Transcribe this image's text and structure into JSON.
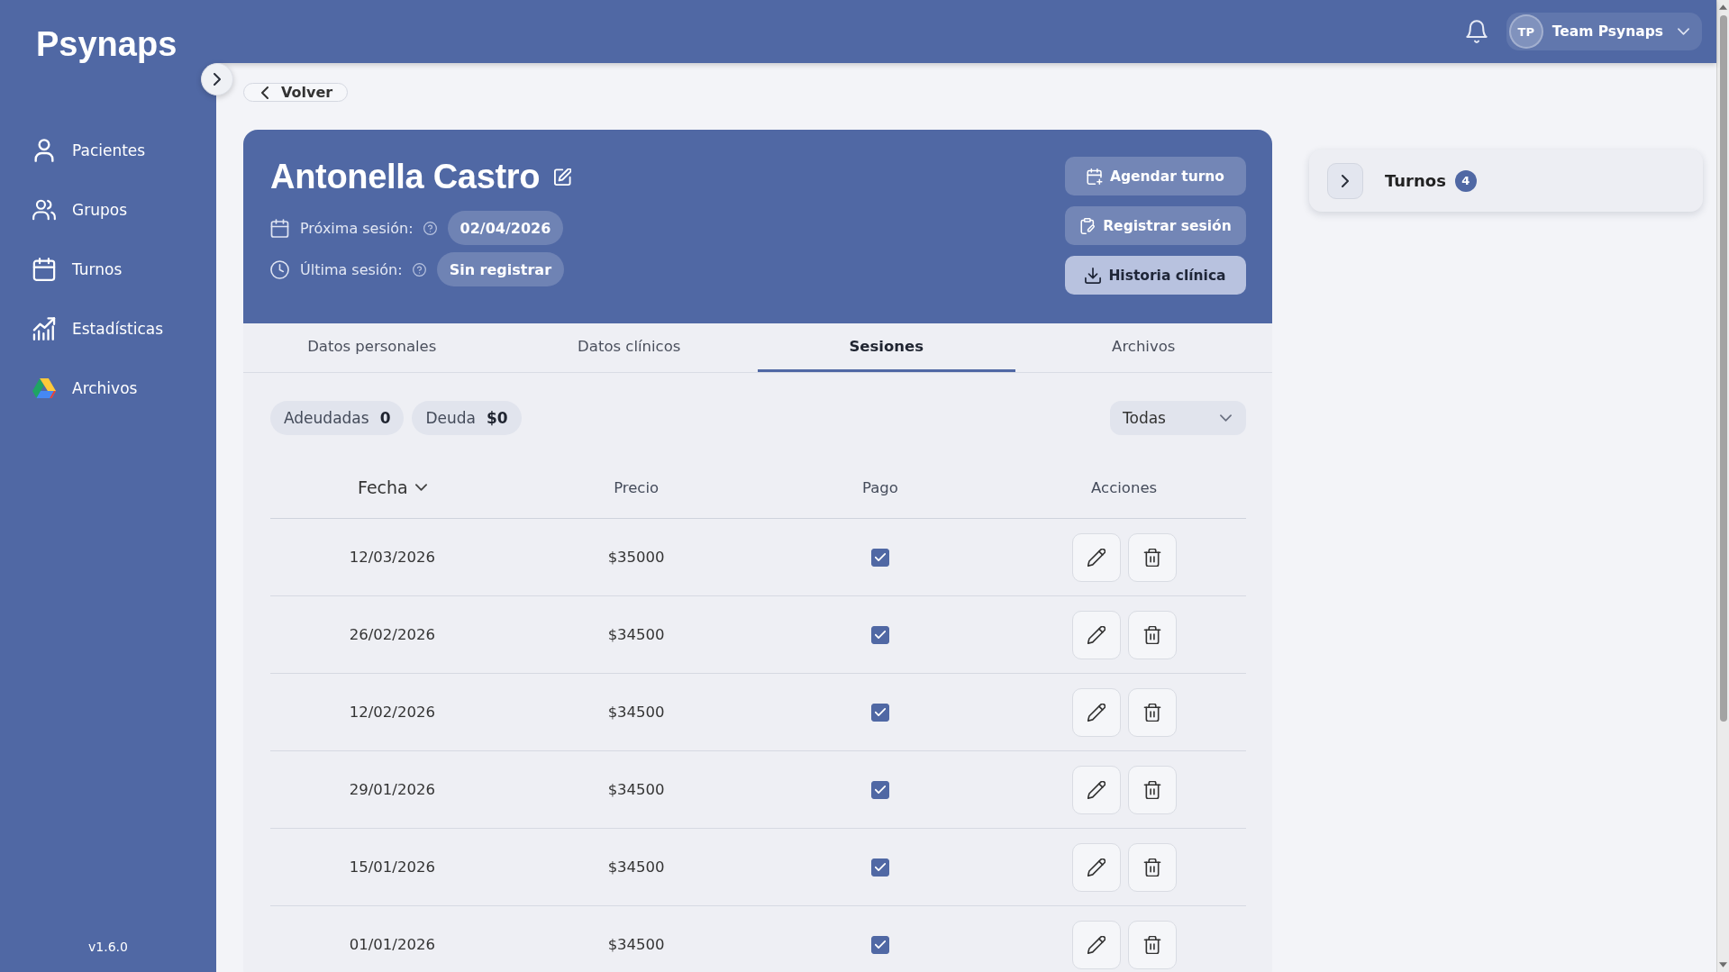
{
  "sidebar": {
    "logo": "Psynaps",
    "items": [
      {
        "label": "Pacientes",
        "selected": false
      },
      {
        "label": "Grupos",
        "selected": false
      },
      {
        "label": "Turnos",
        "selected": false
      },
      {
        "label": "Estadísticas",
        "selected": false
      },
      {
        "label": "Archivos",
        "selected": false
      }
    ],
    "version": "v1.6.0"
  },
  "top_bar": {
    "user": {
      "initials": "TP",
      "name": "Team Psynaps"
    }
  },
  "back_button": {
    "label": "Volver"
  },
  "patient_header": {
    "name": "Antonella Castro",
    "details": [
      {
        "label": "Próxima sesión:",
        "value": "02/04/2026"
      },
      {
        "label": "Última sesión:",
        "value": "Sin registrar"
      }
    ],
    "actions": [
      {
        "label": "Agendar turno",
        "kind": "translucent"
      },
      {
        "label": "Registrar sesión",
        "kind": "translucent"
      },
      {
        "label": "Historia clínica",
        "kind": "light"
      }
    ]
  },
  "tabs": [
    {
      "label": "Datos personales",
      "selected": false
    },
    {
      "label": "Datos clínicos",
      "selected": false
    },
    {
      "label": "Sesiones",
      "selected": true
    },
    {
      "label": "Archivos",
      "selected": false
    }
  ],
  "summary_chips": [
    {
      "label": "Adeudadas",
      "value": "0"
    },
    {
      "label": "Deuda",
      "value": "$0"
    }
  ],
  "filter_dropdown": {
    "value": "Todas"
  },
  "table": {
    "columns": [
      {
        "label": "Fecha",
        "sorted": true
      },
      {
        "label": "Precio",
        "sorted": false
      },
      {
        "label": "Pago",
        "sorted": false
      },
      {
        "label": "Acciones",
        "sorted": false
      }
    ],
    "rows": [
      {
        "date": "12/03/2026",
        "price": "$35000",
        "paid": true
      },
      {
        "date": "26/02/2026",
        "price": "$34500",
        "paid": true
      },
      {
        "date": "12/02/2026",
        "price": "$34500",
        "paid": true
      },
      {
        "date": "29/01/2026",
        "price": "$34500",
        "paid": true
      },
      {
        "date": "15/01/2026",
        "price": "$34500",
        "paid": true
      },
      {
        "date": "01/01/2026",
        "price": "$34500",
        "paid": true
      }
    ]
  },
  "turnos_panel": {
    "title": "Turnos",
    "count": "4",
    "expanded": false
  }
}
